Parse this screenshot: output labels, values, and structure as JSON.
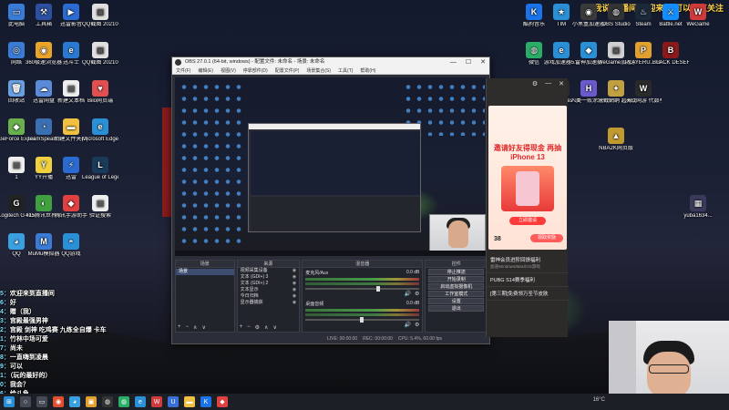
{
  "banner": "听我说 直播间 欢迎来到 可以点点关注",
  "desktop_icons_left": [
    {
      "label": "此电脑",
      "color": "#3a7bd5",
      "glyph": "▭"
    },
    {
      "label": "工具箱",
      "color": "#2c4fa0",
      "glyph": "⚒"
    },
    {
      "label": "迅雷影音",
      "color": "#2b6ad1",
      "glyph": "▶"
    },
    {
      "label": "QQ截图 20210627...",
      "color": "#e0e0e0",
      "glyph": "▣"
    },
    {
      "label": "网络",
      "color": "#3a7bd5",
      "glyph": "◎"
    },
    {
      "label": "360极速浏览器",
      "color": "#e8a52a",
      "glyph": "◉"
    },
    {
      "label": "迅斗士",
      "color": "#2b78d1",
      "glyph": "e"
    },
    {
      "label": "QQ截图 20210627...",
      "color": "#e0e0e0",
      "glyph": "▣"
    },
    {
      "label": "回收站",
      "color": "#6aa0e0",
      "glyph": "🗑"
    },
    {
      "label": "迅雷网盘",
      "color": "#5a8ad8",
      "glyph": "☁"
    },
    {
      "label": "新建文本档",
      "color": "#eeeeee",
      "glyph": "▤"
    },
    {
      "label": "Bilo网页端",
      "color": "#e05050",
      "glyph": "♥"
    },
    {
      "label": "GeForce Experience",
      "color": "#6ab04c",
      "glyph": "◆"
    },
    {
      "label": "TeamSpeak 3",
      "color": "#3a6fb0",
      "glyph": "◔"
    },
    {
      "label": "新建文件夹(2)",
      "color": "#f0c040",
      "glyph": "▬"
    },
    {
      "label": "Microsoft Edge",
      "color": "#2b8fd6",
      "glyph": "e"
    },
    {
      "label": "1",
      "color": "#eeeeee",
      "glyph": "▤"
    },
    {
      "label": "YY开播",
      "color": "#f0d040",
      "glyph": "Y"
    },
    {
      "label": "迅雷",
      "color": "#2b6ad1",
      "glyph": "⚡"
    },
    {
      "label": "League of Legends...",
      "color": "#1a3a5a",
      "glyph": "L"
    },
    {
      "label": "Logitech G HUB",
      "color": "#222222",
      "glyph": "G"
    },
    {
      "label": "415腾讯世界 测速器",
      "color": "#40a040",
      "glyph": "◐"
    },
    {
      "label": "腾讯手游助手",
      "color": "#e04040",
      "glyph": "◆"
    },
    {
      "label": "验证搜索",
      "color": "#eeeeee",
      "glyph": "▤"
    },
    {
      "label": "QQ",
      "color": "#3aa0e0",
      "glyph": "◕"
    },
    {
      "label": "MuMu模拟器",
      "color": "#3a7bd5",
      "glyph": "M"
    },
    {
      "label": "QQ游戏",
      "color": "#2b8fd6",
      "glyph": "◓"
    }
  ],
  "desktop_icons_right": [
    {
      "label": "酷狗音乐",
      "color": "#1a73e8",
      "glyph": "K"
    },
    {
      "label": "TIM",
      "color": "#2b8fd6",
      "glyph": "★"
    },
    {
      "label": "小黑盒加速器",
      "color": "#3a3a3a",
      "glyph": "◉"
    },
    {
      "label": "OBS Studio",
      "color": "#333333",
      "glyph": "◍"
    },
    {
      "label": "Steam",
      "color": "#1b2838",
      "glyph": "♨"
    },
    {
      "label": "Battle.net",
      "color": "#148eff",
      "glyph": "⚔"
    },
    {
      "label": "WeGame",
      "color": "#d03a3a",
      "glyph": "W"
    },
    {
      "label": "微信",
      "color": "#2aae67",
      "glyph": "◍"
    },
    {
      "label": "游戏加速器5.0",
      "color": "#2b8fd6",
      "glyph": "e"
    },
    {
      "label": "雷神加速器",
      "color": "#2b8fd6",
      "glyph": "◆"
    },
    {
      "label": "WeGame加速器",
      "color": "#d0d0d0",
      "glyph": "▣"
    },
    {
      "label": "PLAYERU... BATTLEGR...",
      "color": "#e0a030",
      "glyph": "P"
    },
    {
      "label": "BLACK DESERT",
      "color": "#8a1a1a",
      "glyph": "B"
    },
    {
      "label": "网易UU加速器",
      "color": "#3a6fd8",
      "glyph": "U"
    },
    {
      "label": "Epic Games Launcher",
      "color": "#2a2a2a",
      "glyph": "E"
    },
    {
      "label": "人类一败涂地 Human Fa...",
      "color": "#6a5acd",
      "glyph": "H"
    },
    {
      "label": "決戦網纳 超兽大战",
      "color": "#c0a040",
      "glyph": "✦"
    },
    {
      "label": "决战网游 代数季",
      "color": "#2a2a2a",
      "glyph": "W"
    },
    {
      "label": "NBA2K网页版",
      "color": "#c09a30",
      "glyph": "▲"
    },
    {
      "label": "yuba1634...",
      "color": "#3a3a5a",
      "glyph": "▦"
    }
  ],
  "obs": {
    "title": "OBS 27.0.1 (64-bit, windows) - 配置文件: 未命名 - 场景: 未命名",
    "menu": [
      "文件(F)",
      "编辑(E)",
      "视图(V)",
      "停靠部件(D)",
      "配置文件(P)",
      "场景集合(S)",
      "工具(T)",
      "帮助(H)"
    ],
    "window_buttons": [
      "—",
      "☐",
      "✕"
    ],
    "panel_labels": {
      "scenes": "场景",
      "sources": "来源",
      "mixer": "混音器",
      "controls": "控件"
    },
    "scenes": [
      "场景"
    ],
    "sources": [
      {
        "name": "视频采集设备",
        "eye": "◉"
      },
      {
        "name": "文本 (GDI+) 3",
        "eye": "◉"
      },
      {
        "name": "文本 (GDI+) 2",
        "eye": "◉"
      },
      {
        "name": "文本显示",
        "eye": "◉"
      },
      {
        "name": "今日归档",
        "eye": "◉"
      },
      {
        "name": "显示器捕获",
        "eye": "◉"
      }
    ],
    "mixer": [
      {
        "name": "麦克风/Aux",
        "db": "0.0 dB",
        "level": 0.62
      },
      {
        "name": "桌面音频",
        "db": "0.0 dB",
        "level": 0.48
      }
    ],
    "controls": [
      "停止推流",
      "开始录制",
      "启动虚拟摄像机",
      "工作室模式",
      "设置",
      "退出"
    ],
    "footer_buttons": [
      "+",
      "−",
      "⚙",
      "∧",
      "∨"
    ],
    "status": [
      "LIVE: 00:00:00",
      "REC: 00:00:00",
      "CPU: 5.4%, 60.00 fps"
    ]
  },
  "promo": {
    "controls": [
      "⚙",
      "—",
      "✕"
    ],
    "headline": "邀请好友得现金 再抽iPhone 13",
    "button": "立即邀请",
    "count": "38",
    "count_button": "领取奖励",
    "rows": [
      {
        "title": "雷神会员进阶回馈福利",
        "sub": "加速Windows/Mac/iOS游戏"
      },
      {
        "title": "PUBG S14赛季福利",
        "sub": ""
      },
      {
        "title": "[第三期]免费领万圣节皮肤",
        "sub": ""
      }
    ]
  },
  "chat": [
    {
      "user": "5：",
      "msg": "欢迎来到直播间"
    },
    {
      "user": "6：",
      "msg": "好"
    },
    {
      "user": "4：",
      "msg": "赠（我）"
    },
    {
      "user": "3：",
      "msg": "宫殿最强男神"
    },
    {
      "user": "2：",
      "msg": "宫殿 剑神 吃鸡赛 九练全自爆 卡车"
    },
    {
      "user": "1：",
      "msg": "竹林中场可爱"
    },
    {
      "user": "7：",
      "msg": "尚未"
    },
    {
      "user": "8：",
      "msg": "一直嗨到凌晨"
    },
    {
      "user": "9：",
      "msg": "可以"
    },
    {
      "user": "1：",
      "msg": "（玩的最好的）"
    },
    {
      "user": "0：",
      "msg": "我会？"
    },
    {
      "user": "6：",
      "msg": "给斗鱼"
    }
  ],
  "taskbar_icons": [
    {
      "name": "start",
      "color": "#2b8fd6",
      "glyph": "⊞"
    },
    {
      "name": "search",
      "color": "#444a55",
      "glyph": "○"
    },
    {
      "name": "task-view",
      "color": "#444a55",
      "glyph": "▭"
    },
    {
      "name": "app-1",
      "color": "#e05030",
      "glyph": "◉"
    },
    {
      "name": "app-2",
      "color": "#3aa0e0",
      "glyph": "◕"
    },
    {
      "name": "app-3",
      "color": "#e0a030",
      "glyph": "▣"
    },
    {
      "name": "obs",
      "color": "#333333",
      "glyph": "◍"
    },
    {
      "name": "app-5",
      "color": "#2aae67",
      "glyph": "◍"
    },
    {
      "name": "app-6",
      "color": "#2b8fd6",
      "glyph": "e"
    },
    {
      "name": "app-7",
      "color": "#d03a3a",
      "glyph": "W"
    },
    {
      "name": "app-8",
      "color": "#3a6fd8",
      "glyph": "U"
    },
    {
      "name": "app-9",
      "color": "#f0c040",
      "glyph": "▬"
    },
    {
      "name": "app-10",
      "color": "#1a73e8",
      "glyph": "K"
    },
    {
      "name": "app-11",
      "color": "#e04040",
      "glyph": "◆"
    }
  ],
  "tray_text": "16°C"
}
